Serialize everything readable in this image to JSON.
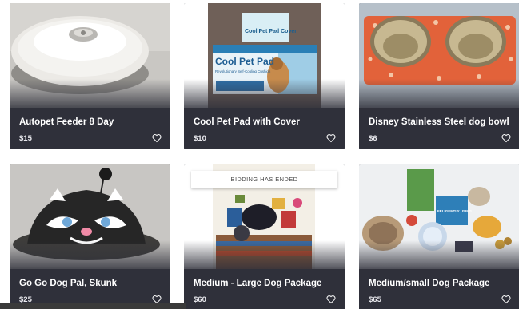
{
  "listings": [
    {
      "title": "Autopet Feeder 8 Day",
      "price": "$15",
      "favorite_icon": "heart-outline-icon"
    },
    {
      "title": "Cool Pet Pad with Cover",
      "price": "$10",
      "favorite_icon": "heart-outline-icon",
      "product_box": {
        "brand_tag": "Cool Pet Pad Cover",
        "headline": "Cool Pet Pad",
        "tagline": "Revolutionary Self-Cooling Cushion"
      }
    },
    {
      "title": "Disney Stainless Steel dog bowl",
      "price": "$6",
      "favorite_icon": "heart-outline-icon"
    },
    {
      "title": "Go Go Dog Pal, Skunk",
      "price": "$25",
      "favorite_icon": "heart-outline-icon"
    },
    {
      "title": "Medium - Large Dog Package",
      "price": "$60",
      "favorite_icon": "heart-outline-icon",
      "status_badge": "BIDDING HAS ENDED"
    },
    {
      "title": "Medium/small Dog Package",
      "price": "$65",
      "favorite_icon": "heart-outline-icon",
      "product_label": "FELIGENTLY USING"
    }
  ],
  "colors": {
    "card_bg": "#2f303a",
    "title": "#ffffff",
    "price": "#e9e9ee"
  }
}
